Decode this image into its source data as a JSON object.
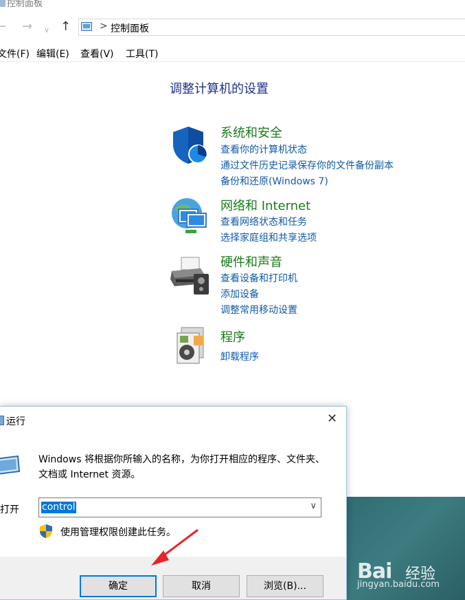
{
  "cp": {
    "window_title": "控制面板",
    "breadcrumb": "控制面板",
    "breadcrumb_sep": ">",
    "menu": [
      "文件(F)",
      "编辑(E)",
      "查看(V)",
      "工具(T)"
    ],
    "heading": "调整计算机的设置",
    "categories": [
      {
        "title": "系统和安全",
        "icon": "shield-icon",
        "links": [
          "查看你的计算机状态",
          "通过文件历史记录保存你的文件备份副本",
          "备份和还原(Windows 7)"
        ]
      },
      {
        "title": "网络和 Internet",
        "icon": "network-icon",
        "links": [
          "查看网络状态和任务",
          "选择家庭组和共享选项"
        ]
      },
      {
        "title": "硬件和声音",
        "icon": "printer-icon",
        "links": [
          "查看设备和打印机",
          "添加设备",
          "调整常用移动设置"
        ]
      },
      {
        "title": "程序",
        "icon": "programs-icon",
        "links": [
          "卸载程序"
        ]
      }
    ]
  },
  "run": {
    "title": "运行",
    "close": "✕",
    "description": "Windows 将根据你所输入的名称，为你打开相应的程序、文件夹、文档或 Internet 资源。",
    "open_label": "打开",
    "value": "control",
    "admin_note": "使用管理权限创建此任务。",
    "buttons": {
      "ok": "确定",
      "cancel": "取消",
      "browse": "浏览(B)..."
    }
  },
  "watermark": {
    "logo": "Bai",
    "name": "经验",
    "url": "jingyan.baidu.com"
  },
  "colors": {
    "link": "#0f5aa8",
    "category": "#1b7a1b",
    "heading": "#1e3287",
    "accent": "#0078d7",
    "annotation_arrow": "#e8232a"
  }
}
